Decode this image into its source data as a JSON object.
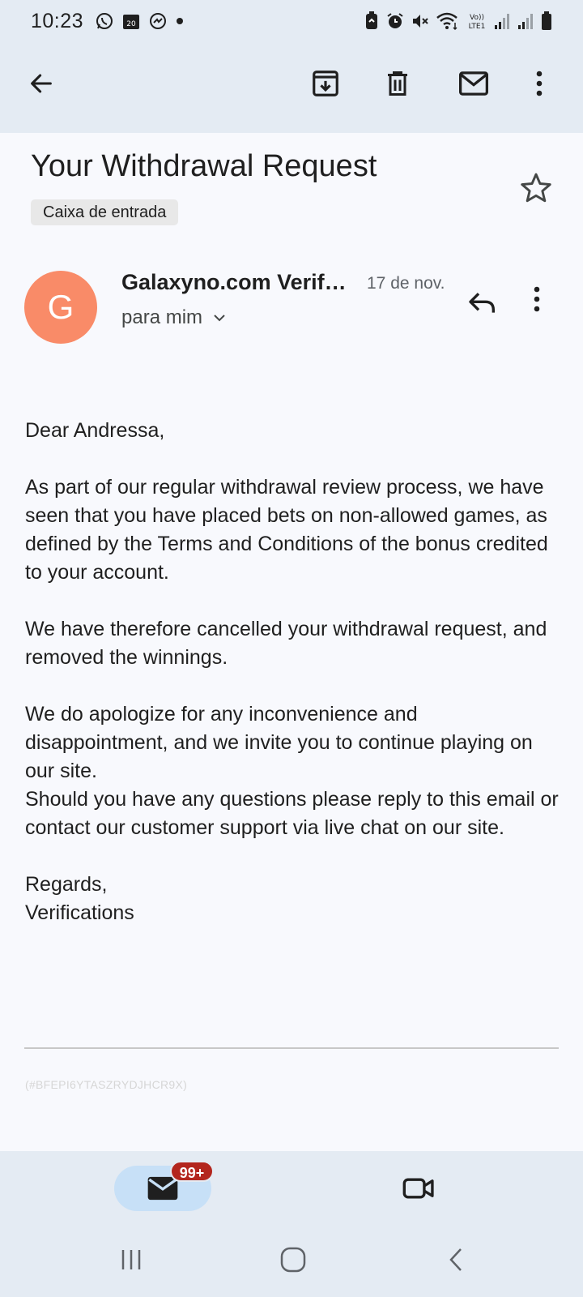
{
  "status_bar": {
    "time": "10:23",
    "left_icons": [
      "whatsapp-icon",
      "calendar-icon",
      "messenger-icon",
      "dot-icon"
    ],
    "calendar_day": "20",
    "right_icons": [
      "battery-saver-icon",
      "alarm-icon",
      "mute-icon",
      "wifi-icon",
      "volte-icon",
      "signal-icon",
      "signal-icon",
      "battery-icon"
    ],
    "volte_label": "Vo)) LTE1"
  },
  "toolbar": {
    "back": "arrow-back-icon",
    "archive": "archive-icon",
    "delete": "trash-icon",
    "mark_unread": "mail-icon",
    "more": "more-vert-icon"
  },
  "email": {
    "subject": "Your Withdrawal Request",
    "label": "Caixa de entrada",
    "starred": false,
    "sender": {
      "initial": "G",
      "name": "Galaxyno.com Verifications",
      "avatar_color": "#f98b68"
    },
    "date": "17 de nov.",
    "recipient": "para mim",
    "body": {
      "greeting": "Dear Andressa,",
      "p1": "As part of our regular withdrawal review process, we have seen that you have placed bets on non-allowed games, as defined by the Terms and Conditions of the bonus credited to your account.",
      "p2": "We have therefore cancelled your withdrawal request, and removed the winnings.",
      "p3a": "We do apologize for any inconvenience and disappointment, and we invite you to continue playing on our site.",
      "p3b": "Should you have any questions please reply to this email or contact our customer support via live chat on our site.",
      "closing": "Regards,",
      "signature": "Verifications"
    },
    "reference": "(#BFEPI6YTASZRYDJHCR9X)"
  },
  "bottom_nav": {
    "mail_badge": "99+",
    "items": [
      "mail-icon",
      "video-icon"
    ]
  },
  "colors": {
    "header_bg": "#e4ebf3",
    "page_bg": "#f8f9fd",
    "nav_active": "#c7e0f7",
    "badge": "#b3261e"
  }
}
